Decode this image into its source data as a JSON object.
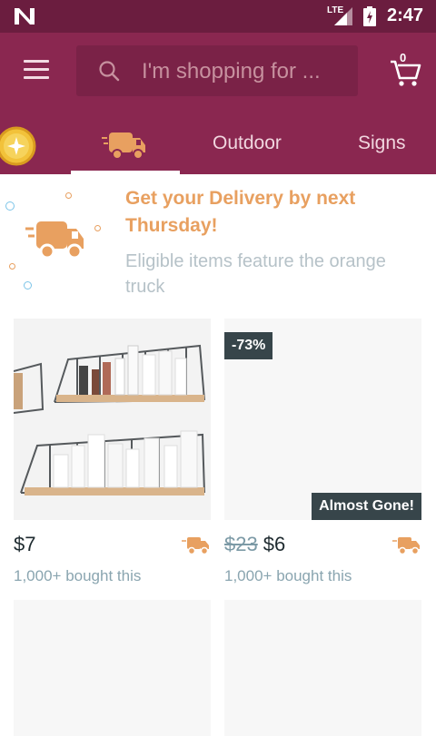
{
  "status_bar": {
    "network": "LTE",
    "time": "2:47"
  },
  "header": {
    "search_placeholder": "I'm shopping for ...",
    "cart_count": "0"
  },
  "tabs": [
    {
      "label": ""
    },
    {
      "label": ""
    },
    {
      "label": "Outdoor"
    },
    {
      "label": "Signs"
    }
  ],
  "banner": {
    "title": "Get your Delivery by next Thursday!",
    "subtitle": "Eligible items feature the orange truck"
  },
  "products": [
    {
      "price": "$7",
      "old_price": "",
      "bought": "1,000+ bought this",
      "discount": "",
      "badge": ""
    },
    {
      "price": "$6",
      "old_price": "$23",
      "bought": "1,000+ bought this",
      "discount": "-73%",
      "badge": "Almost Gone!"
    }
  ],
  "colors": {
    "status_bar": "#6b1d3f",
    "app_bar": "#8a2750",
    "accent_orange": "#e8a060",
    "badge_dark": "#37454a"
  },
  "icons": [
    "n-logo-icon",
    "signal-icon",
    "battery-icon",
    "menu-icon",
    "search-icon",
    "cart-icon",
    "coin-icon",
    "delivery-truck-icon"
  ]
}
